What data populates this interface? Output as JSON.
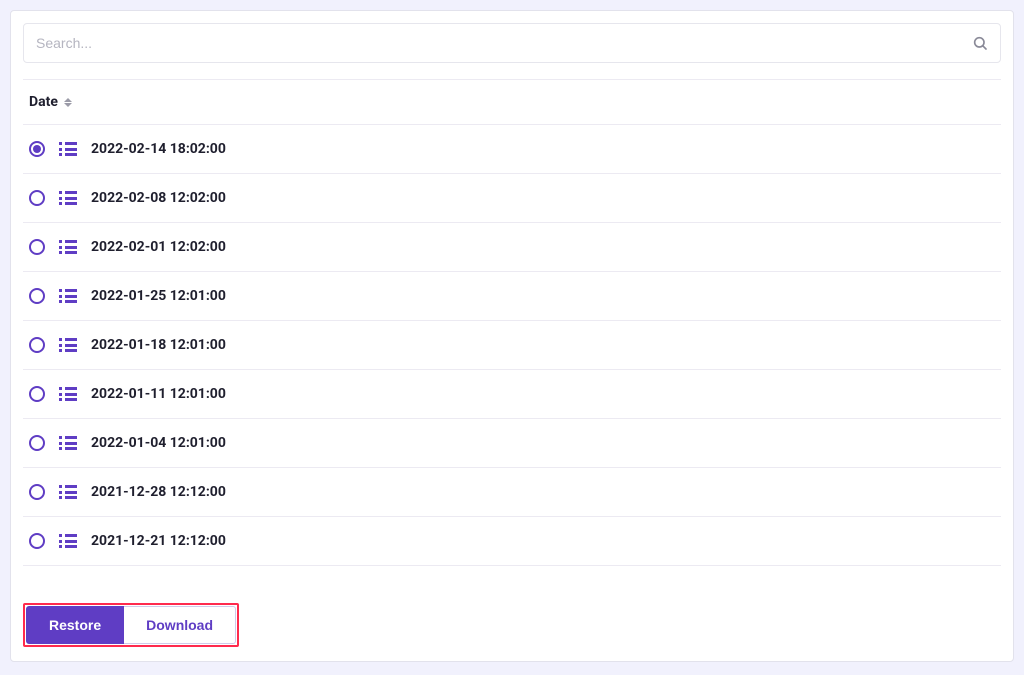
{
  "search": {
    "placeholder": "Search..."
  },
  "table": {
    "column_header": "Date",
    "rows": [
      {
        "label": "2022-02-14 18:02:00",
        "selected": true
      },
      {
        "label": "2022-02-08 12:02:00",
        "selected": false
      },
      {
        "label": "2022-02-01 12:02:00",
        "selected": false
      },
      {
        "label": "2022-01-25 12:01:00",
        "selected": false
      },
      {
        "label": "2022-01-18 12:01:00",
        "selected": false
      },
      {
        "label": "2022-01-11 12:01:00",
        "selected": false
      },
      {
        "label": "2022-01-04 12:01:00",
        "selected": false
      },
      {
        "label": "2021-12-28 12:12:00",
        "selected": false
      },
      {
        "label": "2021-12-21 12:12:00",
        "selected": false
      }
    ]
  },
  "footer": {
    "restore_label": "Restore",
    "download_label": "Download"
  },
  "colors": {
    "accent": "#5f3dc4",
    "highlight_border": "#ff2a4d"
  }
}
